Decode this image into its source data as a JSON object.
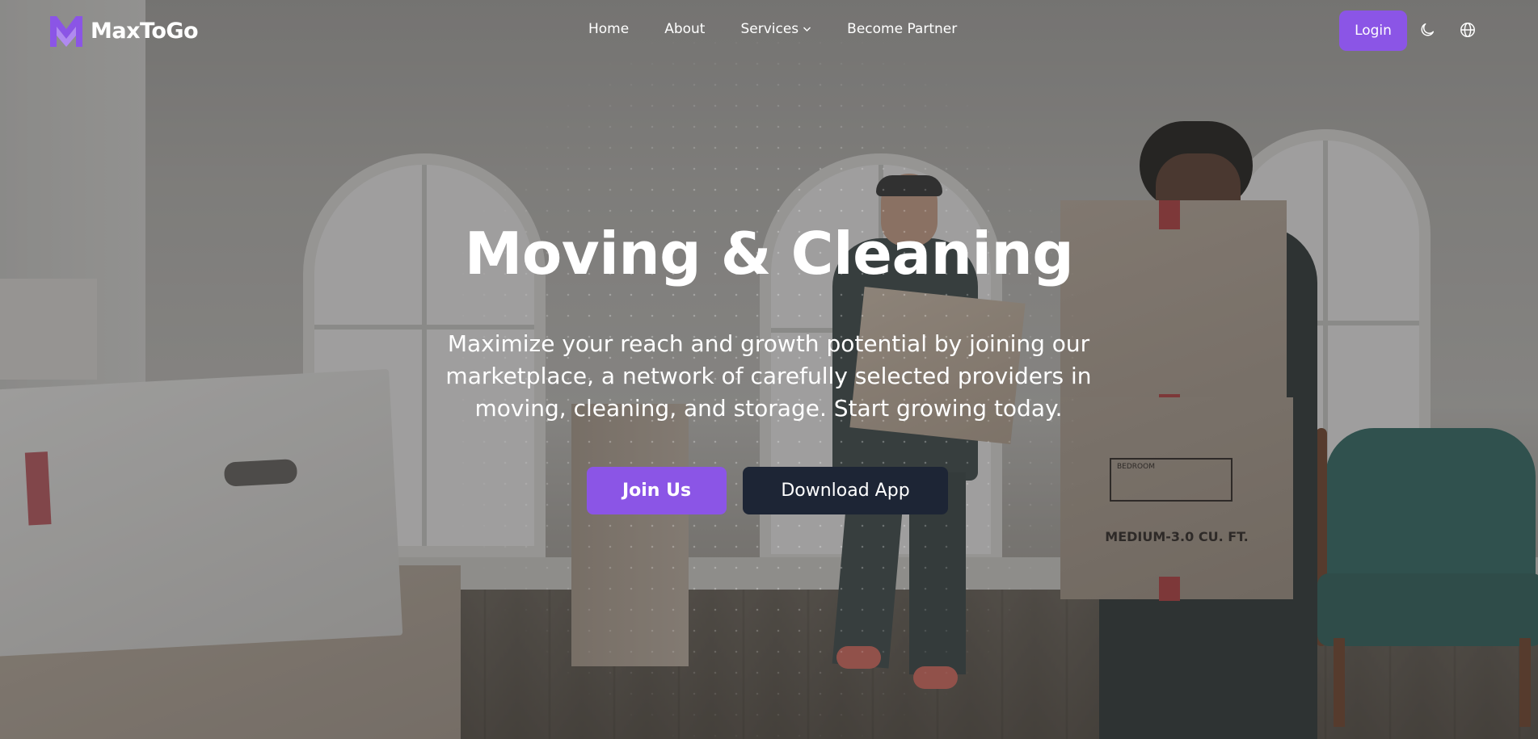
{
  "brand": {
    "name": "MaxToGo",
    "accent": "#8b55e6"
  },
  "nav": {
    "items": [
      {
        "label": "Home"
      },
      {
        "label": "About"
      },
      {
        "label": "Services",
        "has_dropdown": true
      },
      {
        "label": "Become Partner"
      }
    ]
  },
  "header_actions": {
    "login_label": "Login",
    "theme_icon": "moon-icon",
    "language_icon": "globe-icon"
  },
  "hero": {
    "title": "Moving & Cleaning",
    "subtitle": "Maximize your reach and growth potential by joining our marketplace, a network of carefully selected providers in moving, cleaning, and storage. Start growing today.",
    "primary_cta": "Join Us",
    "secondary_cta": "Download App",
    "secondary_cta_color": "#1d2535",
    "box_label": "MEDIUM-3.0 CU. FT.",
    "box_title": "BEDROOM"
  }
}
